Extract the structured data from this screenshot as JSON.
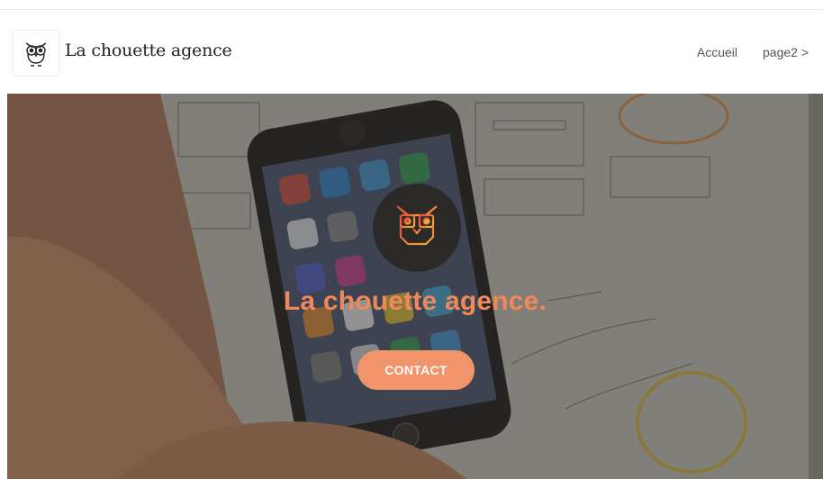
{
  "brand": {
    "name": "La chouette agence",
    "logo_icon": "owl-icon"
  },
  "nav": {
    "items": [
      {
        "label": "Accueil"
      },
      {
        "label": "page2 >"
      }
    ]
  },
  "hero": {
    "badge_icon": "owl-icon",
    "title": "La chouette agence.",
    "cta_label": "CONTACT"
  },
  "colors": {
    "accent": "#f2946a",
    "title": "#f0885a",
    "badge_bg": "#2c2a28",
    "owl_gradient_start": "#e8453c",
    "owl_gradient_end": "#f5b23a"
  }
}
